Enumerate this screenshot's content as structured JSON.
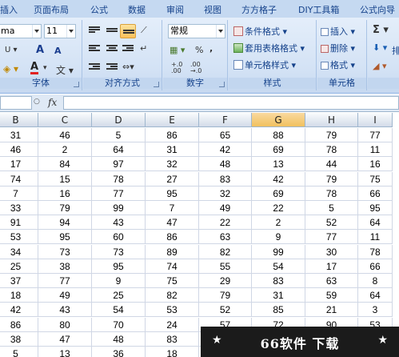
{
  "menu": {
    "tabs": [
      "插入",
      "页面布局",
      "公式",
      "数据",
      "审阅",
      "视图",
      "方方格子",
      "DIY工具箱",
      "公式向导"
    ]
  },
  "ribbon": {
    "font_group": {
      "font_name": "ma",
      "font_size": "11",
      "grow_font": "A",
      "shrink_font": "A",
      "font_color_letter": "A",
      "label": "字体"
    },
    "alignment_group": {
      "label": "对齐方式"
    },
    "number_group": {
      "format": "常规",
      "percent": "%",
      "comma": ",",
      "increase_decimal": "+.0\n.00",
      "increase_decimal_top": "+.0",
      "increase_decimal_bottom": ".00",
      "decrease_decimal_top": ".00",
      "decrease_decimal_bottom": "→.0",
      "label": "数字"
    },
    "styles_group": {
      "conditional_format": "条件格式",
      "table_format": "套用表格格式",
      "cell_styles": "单元格样式",
      "label": "样式"
    },
    "cells_group": {
      "insert": "插入",
      "delete": "删除",
      "format": "格式",
      "label": "单元格"
    },
    "editing_group": {
      "sum_symbol": "Σ",
      "partial_text": "排"
    }
  },
  "formula_bar": {
    "fx": "fx"
  },
  "sheet": {
    "columns": [
      "B",
      "C",
      "D",
      "E",
      "F",
      "G",
      "H",
      "I"
    ],
    "selected_column": "G",
    "rows": [
      [
        "31",
        "46",
        "5",
        "86",
        "65",
        "88",
        "79",
        "77"
      ],
      [
        "46",
        "2",
        "64",
        "31",
        "42",
        "69",
        "78",
        "11"
      ],
      [
        "17",
        "84",
        "97",
        "32",
        "48",
        "13",
        "44",
        "16"
      ],
      [
        "74",
        "15",
        "78",
        "27",
        "83",
        "42",
        "79",
        "75"
      ],
      [
        "7",
        "16",
        "77",
        "95",
        "32",
        "69",
        "78",
        "66"
      ],
      [
        "33",
        "79",
        "99",
        "7",
        "49",
        "22",
        "5",
        "95"
      ],
      [
        "91",
        "94",
        "43",
        "47",
        "22",
        "2",
        "52",
        "64"
      ],
      [
        "53",
        "95",
        "60",
        "86",
        "63",
        "9",
        "77",
        "11"
      ],
      [
        "34",
        "73",
        "73",
        "89",
        "82",
        "99",
        "30",
        "78"
      ],
      [
        "25",
        "38",
        "95",
        "74",
        "55",
        "54",
        "17",
        "66"
      ],
      [
        "37",
        "77",
        "9",
        "75",
        "29",
        "83",
        "63",
        "8"
      ],
      [
        "18",
        "49",
        "25",
        "82",
        "79",
        "31",
        "59",
        "64"
      ],
      [
        "42",
        "43",
        "54",
        "53",
        "52",
        "85",
        "21",
        "3"
      ],
      [
        "86",
        "80",
        "70",
        "24",
        "57",
        "72",
        "90",
        "53"
      ],
      [
        "38",
        "47",
        "48",
        "83",
        "",
        "",
        "",
        ""
      ],
      [
        "5",
        "13",
        "36",
        "18",
        "",
        "",
        "",
        ""
      ]
    ]
  },
  "watermark": {
    "text": "66软件 下载",
    "star": "★"
  },
  "colors": {
    "selected_header": "#f1c15f",
    "ribbon_bg": "#d3e2f5",
    "banner_bg": "#1b1b1b"
  }
}
